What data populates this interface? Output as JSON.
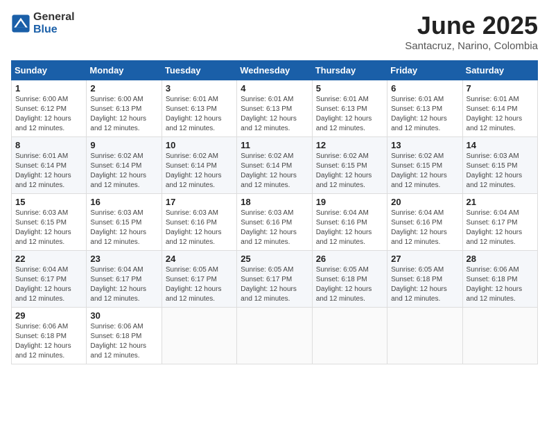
{
  "logo": {
    "general": "General",
    "blue": "Blue"
  },
  "title": {
    "month": "June 2025",
    "location": "Santacruz, Narino, Colombia"
  },
  "weekdays": [
    "Sunday",
    "Monday",
    "Tuesday",
    "Wednesday",
    "Thursday",
    "Friday",
    "Saturday"
  ],
  "weeks": [
    [
      {
        "day": "1",
        "sunrise": "6:00 AM",
        "sunset": "6:12 PM",
        "daylight": "12 hours and 12 minutes."
      },
      {
        "day": "2",
        "sunrise": "6:00 AM",
        "sunset": "6:13 PM",
        "daylight": "12 hours and 12 minutes."
      },
      {
        "day": "3",
        "sunrise": "6:01 AM",
        "sunset": "6:13 PM",
        "daylight": "12 hours and 12 minutes."
      },
      {
        "day": "4",
        "sunrise": "6:01 AM",
        "sunset": "6:13 PM",
        "daylight": "12 hours and 12 minutes."
      },
      {
        "day": "5",
        "sunrise": "6:01 AM",
        "sunset": "6:13 PM",
        "daylight": "12 hours and 12 minutes."
      },
      {
        "day": "6",
        "sunrise": "6:01 AM",
        "sunset": "6:13 PM",
        "daylight": "12 hours and 12 minutes."
      },
      {
        "day": "7",
        "sunrise": "6:01 AM",
        "sunset": "6:14 PM",
        "daylight": "12 hours and 12 minutes."
      }
    ],
    [
      {
        "day": "8",
        "sunrise": "6:01 AM",
        "sunset": "6:14 PM",
        "daylight": "12 hours and 12 minutes."
      },
      {
        "day": "9",
        "sunrise": "6:02 AM",
        "sunset": "6:14 PM",
        "daylight": "12 hours and 12 minutes."
      },
      {
        "day": "10",
        "sunrise": "6:02 AM",
        "sunset": "6:14 PM",
        "daylight": "12 hours and 12 minutes."
      },
      {
        "day": "11",
        "sunrise": "6:02 AM",
        "sunset": "6:14 PM",
        "daylight": "12 hours and 12 minutes."
      },
      {
        "day": "12",
        "sunrise": "6:02 AM",
        "sunset": "6:15 PM",
        "daylight": "12 hours and 12 minutes."
      },
      {
        "day": "13",
        "sunrise": "6:02 AM",
        "sunset": "6:15 PM",
        "daylight": "12 hours and 12 minutes."
      },
      {
        "day": "14",
        "sunrise": "6:03 AM",
        "sunset": "6:15 PM",
        "daylight": "12 hours and 12 minutes."
      }
    ],
    [
      {
        "day": "15",
        "sunrise": "6:03 AM",
        "sunset": "6:15 PM",
        "daylight": "12 hours and 12 minutes."
      },
      {
        "day": "16",
        "sunrise": "6:03 AM",
        "sunset": "6:15 PM",
        "daylight": "12 hours and 12 minutes."
      },
      {
        "day": "17",
        "sunrise": "6:03 AM",
        "sunset": "6:16 PM",
        "daylight": "12 hours and 12 minutes."
      },
      {
        "day": "18",
        "sunrise": "6:03 AM",
        "sunset": "6:16 PM",
        "daylight": "12 hours and 12 minutes."
      },
      {
        "day": "19",
        "sunrise": "6:04 AM",
        "sunset": "6:16 PM",
        "daylight": "12 hours and 12 minutes."
      },
      {
        "day": "20",
        "sunrise": "6:04 AM",
        "sunset": "6:16 PM",
        "daylight": "12 hours and 12 minutes."
      },
      {
        "day": "21",
        "sunrise": "6:04 AM",
        "sunset": "6:17 PM",
        "daylight": "12 hours and 12 minutes."
      }
    ],
    [
      {
        "day": "22",
        "sunrise": "6:04 AM",
        "sunset": "6:17 PM",
        "daylight": "12 hours and 12 minutes."
      },
      {
        "day": "23",
        "sunrise": "6:04 AM",
        "sunset": "6:17 PM",
        "daylight": "12 hours and 12 minutes."
      },
      {
        "day": "24",
        "sunrise": "6:05 AM",
        "sunset": "6:17 PM",
        "daylight": "12 hours and 12 minutes."
      },
      {
        "day": "25",
        "sunrise": "6:05 AM",
        "sunset": "6:17 PM",
        "daylight": "12 hours and 12 minutes."
      },
      {
        "day": "26",
        "sunrise": "6:05 AM",
        "sunset": "6:18 PM",
        "daylight": "12 hours and 12 minutes."
      },
      {
        "day": "27",
        "sunrise": "6:05 AM",
        "sunset": "6:18 PM",
        "daylight": "12 hours and 12 minutes."
      },
      {
        "day": "28",
        "sunrise": "6:06 AM",
        "sunset": "6:18 PM",
        "daylight": "12 hours and 12 minutes."
      }
    ],
    [
      {
        "day": "29",
        "sunrise": "6:06 AM",
        "sunset": "6:18 PM",
        "daylight": "12 hours and 12 minutes."
      },
      {
        "day": "30",
        "sunrise": "6:06 AM",
        "sunset": "6:18 PM",
        "daylight": "12 hours and 12 minutes."
      },
      null,
      null,
      null,
      null,
      null
    ]
  ]
}
